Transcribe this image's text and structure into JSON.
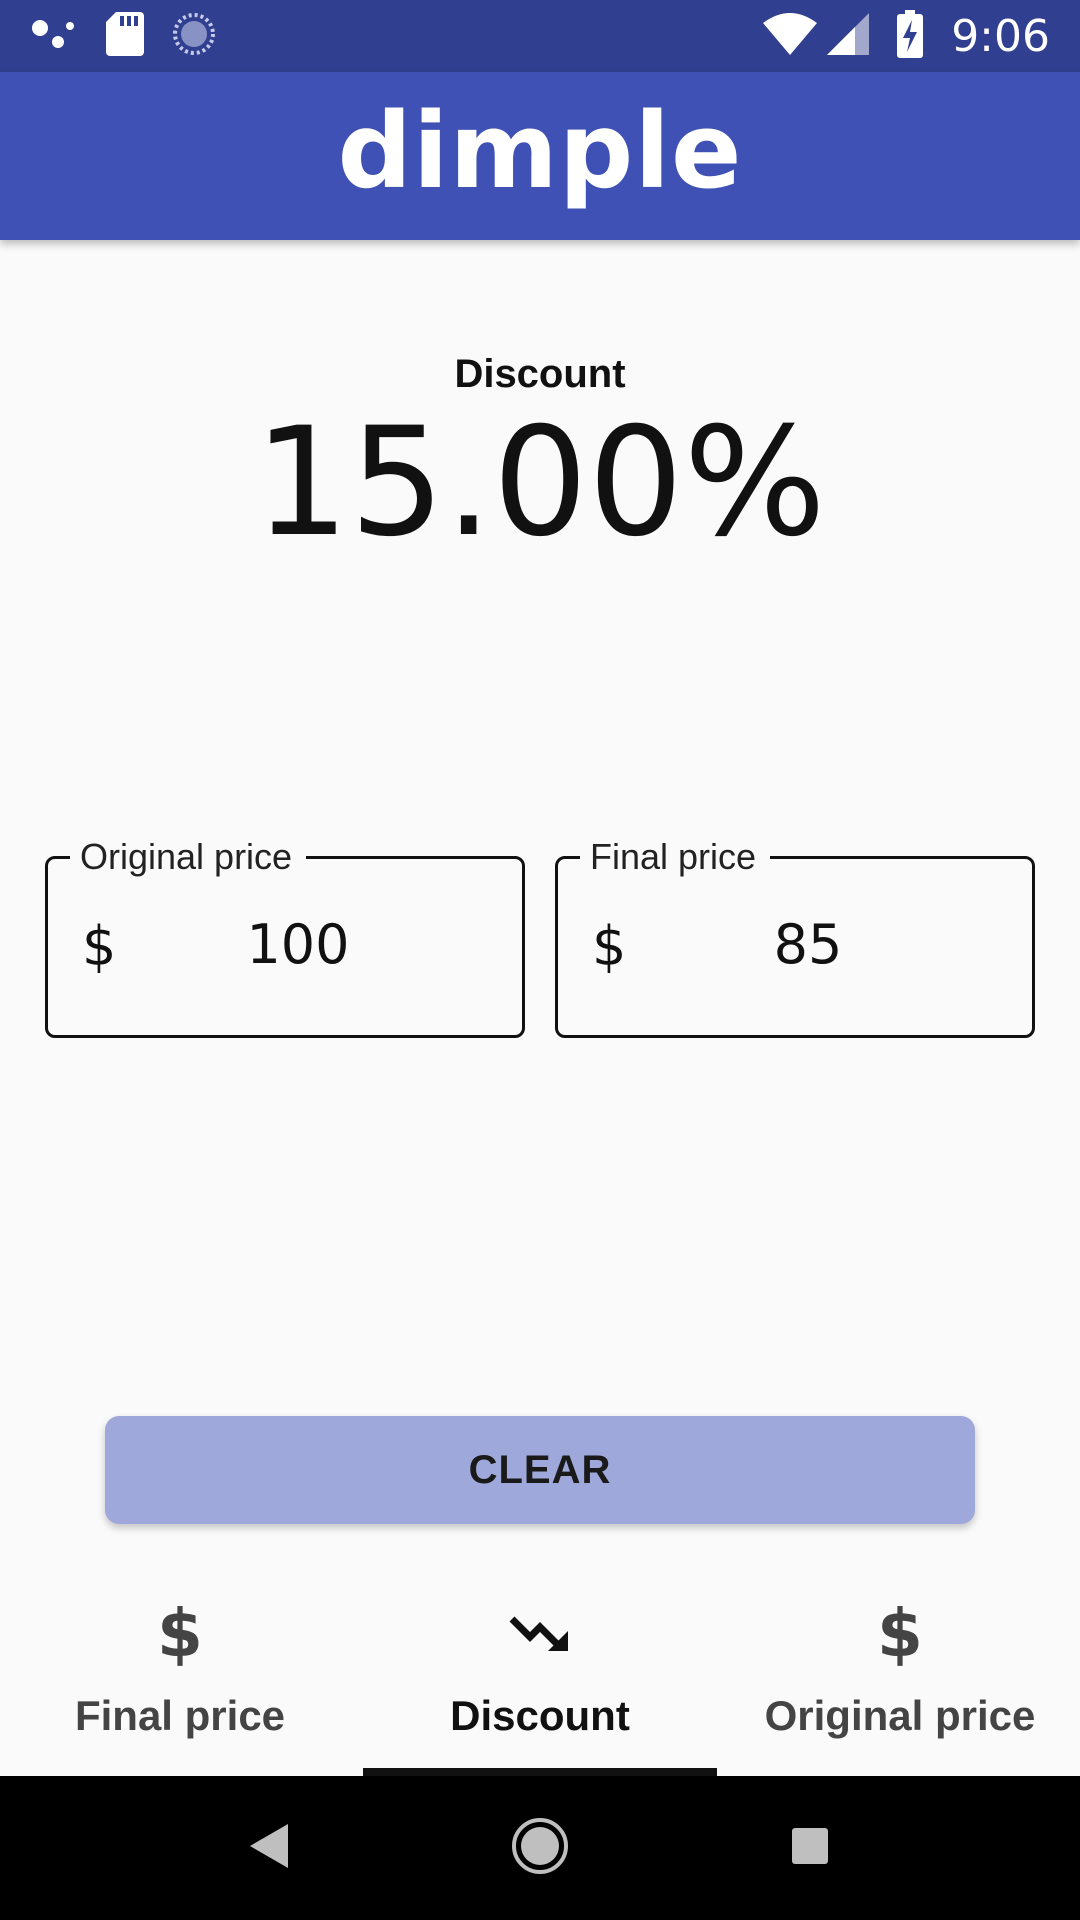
{
  "status_bar": {
    "time": "9:06",
    "left_icons": [
      "assistant-dots-icon",
      "sd-card-icon",
      "sync-icon"
    ],
    "right_icons": [
      "wifi-icon",
      "cell-signal-icon",
      "battery-charging-icon"
    ]
  },
  "app_bar": {
    "title": "dimple"
  },
  "result": {
    "label": "Discount",
    "value": "15.00%"
  },
  "fields": {
    "original": {
      "label": "Original price",
      "prefix": "$",
      "value": "100"
    },
    "final": {
      "label": "Final price",
      "prefix": "$",
      "value": "85"
    }
  },
  "actions": {
    "clear_label": "CLEAR"
  },
  "tabs": [
    {
      "label": "Final price",
      "icon": "dollar-icon",
      "active": false
    },
    {
      "label": "Discount",
      "icon": "trending-down-icon",
      "active": true
    },
    {
      "label": "Original price",
      "icon": "dollar-icon",
      "active": false
    }
  ],
  "tab_icon_glyph": "$",
  "nav_bar": {
    "buttons": [
      "back-icon",
      "home-icon",
      "recents-icon"
    ]
  },
  "colors": {
    "status_bar": "#303f8f",
    "app_bar": "#3f51b5",
    "clear_button": "#9fa8da",
    "background": "#fafafa"
  }
}
